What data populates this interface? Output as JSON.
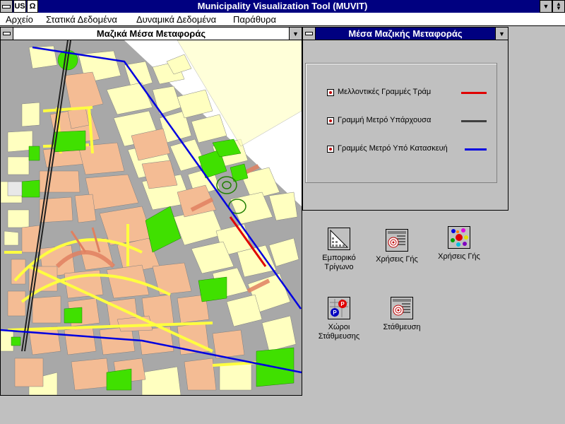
{
  "app": {
    "title": "Municipality Visualization Tool (MUVIT)",
    "lang_indicator": "US",
    "omega_glyph": "Ω"
  },
  "menu": {
    "items": [
      "Αρχείο",
      "Στατικά Δεδομένα",
      "Δυναμικά Δεδομένα",
      "Παράθυρα"
    ]
  },
  "map_window": {
    "title": "Μαζικά Μέσα Μεταφοράς"
  },
  "legend_window": {
    "title": "Μέσα Μαζικής Μεταφοράς",
    "entries": [
      {
        "label": "Μελλοντικές Γραμμές Τράμ",
        "color": "#e00000",
        "checked": true
      },
      {
        "label": "Γραμμή Μετρό Υπάρχουσα",
        "color": "#404040",
        "checked": true
      },
      {
        "label": "Γραμμές Μετρό Υπό Κατασκευή",
        "color": "#0000e0",
        "checked": true
      }
    ]
  },
  "desktop_icons": [
    {
      "label": "Εμπορικό Τρίγωνο",
      "icon": "commercial-triangle-icon"
    },
    {
      "label": "Χρήσεις Γής",
      "icon": "land-use-chart-icon"
    },
    {
      "label": "Χρήσεις Γής",
      "icon": "land-use-map-icon"
    },
    {
      "label": "Χώροι Στάθμευσης",
      "icon": "parking-spaces-icon"
    },
    {
      "label": "Στάθμευση",
      "icon": "parking-chart-icon"
    }
  ],
  "colors": {
    "titlebar": "#000080",
    "desktop": "#c0c0c0",
    "road": "#a8a8a8",
    "block_residential": "#ffffc0",
    "block_commercial": "#f4bc94",
    "park": "#40e000",
    "main_road": "#ffff40"
  }
}
